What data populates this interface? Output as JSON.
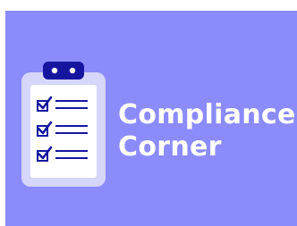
{
  "badge": {
    "title_line_1": "Compliance",
    "title_line_2": "Corner",
    "icon": "clipboard-checklist-icon",
    "colors": {
      "background": "#8b8bfb",
      "text": "#ffffff",
      "clipboard_back": "#d6d6fb",
      "paper": "#ffffff",
      "accent": "#1515a0"
    }
  }
}
